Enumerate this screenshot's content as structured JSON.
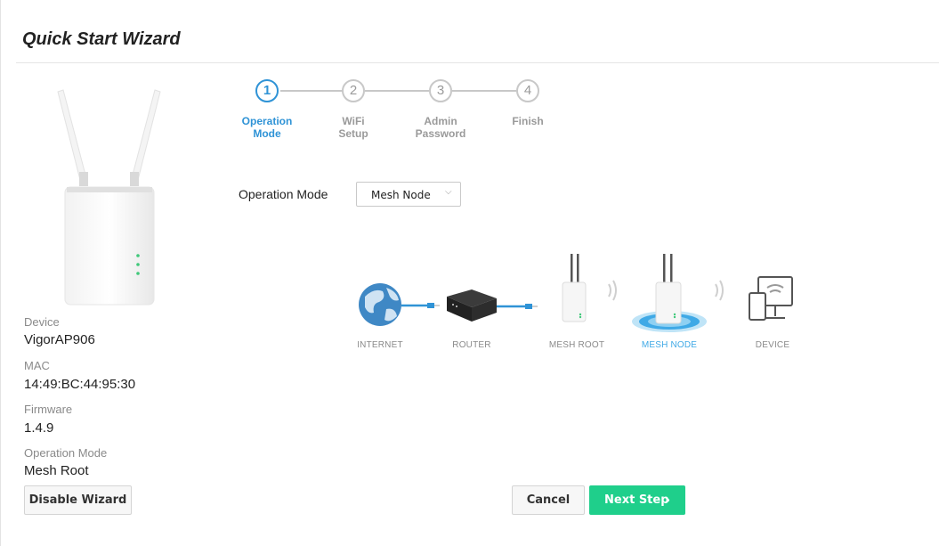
{
  "page": {
    "title": "Quick Start Wizard"
  },
  "steps": [
    {
      "number": "1",
      "label_line1": "Operation",
      "label_line2": "Mode",
      "active": true
    },
    {
      "number": "2",
      "label_line1": "WiFi",
      "label_line2": "Setup",
      "active": false
    },
    {
      "number": "3",
      "label_line1": "Admin",
      "label_line2": "Password",
      "active": false
    },
    {
      "number": "4",
      "label_line1": "Finish",
      "label_line2": "",
      "active": false
    }
  ],
  "operation_mode": {
    "label": "Operation Mode",
    "selected": "Mesh Node"
  },
  "diagram": {
    "labels": [
      "INTERNET",
      "ROUTER",
      "MESH ROOT",
      "MESH NODE",
      "DEVICE"
    ],
    "highlighted": "MESH NODE"
  },
  "device_info": {
    "device_label": "Device",
    "device_value": "VigorAP906",
    "mac_label": "MAC",
    "mac_value": "14:49:BC:44:95:30",
    "firmware_label": "Firmware",
    "firmware_value": "1.4.9",
    "mode_label": "Operation Mode",
    "mode_value": "Mesh Root"
  },
  "buttons": {
    "disable_wizard": "Disable Wizard",
    "cancel": "Cancel",
    "next_step": "Next Step"
  },
  "colors": {
    "accent": "#2f93d6",
    "next_button": "#1fcf8b",
    "highlight": "#3fa9e6"
  }
}
